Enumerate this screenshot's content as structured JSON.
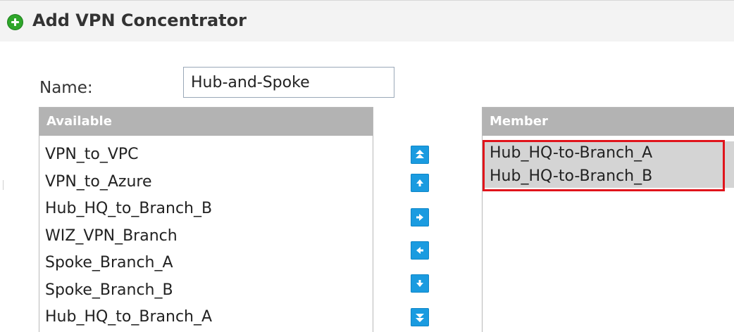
{
  "dialog": {
    "title": "Add VPN Concentrator"
  },
  "form": {
    "name_label": "Name:",
    "name_value": "Hub-and-Spoke"
  },
  "available": {
    "header": "Available",
    "items": [
      "VPN_to_VPC",
      "VPN_to_Azure",
      "Hub_HQ_to_Branch_B",
      "WIZ_VPN_Branch",
      "Spoke_Branch_A",
      "Spoke_Branch_B",
      "Hub_HQ_to_Branch_A"
    ]
  },
  "member": {
    "header": "Member",
    "items": [
      "Hub_HQ-to-Branch_A",
      "Hub_HQ-to-Branch_B"
    ]
  },
  "buttons": {
    "move_top": "double-up-arrow-icon",
    "move_up": "up-arrow-icon",
    "add": "right-arrow-icon",
    "remove": "left-arrow-icon",
    "move_down": "down-arrow-icon",
    "move_bottom": "double-down-arrow-icon"
  },
  "colors": {
    "button_blue": "#1a9be0",
    "header_gray": "#b3b3b3",
    "highlight_red": "#e0141b",
    "add_icon_green": "#2ea62a"
  }
}
